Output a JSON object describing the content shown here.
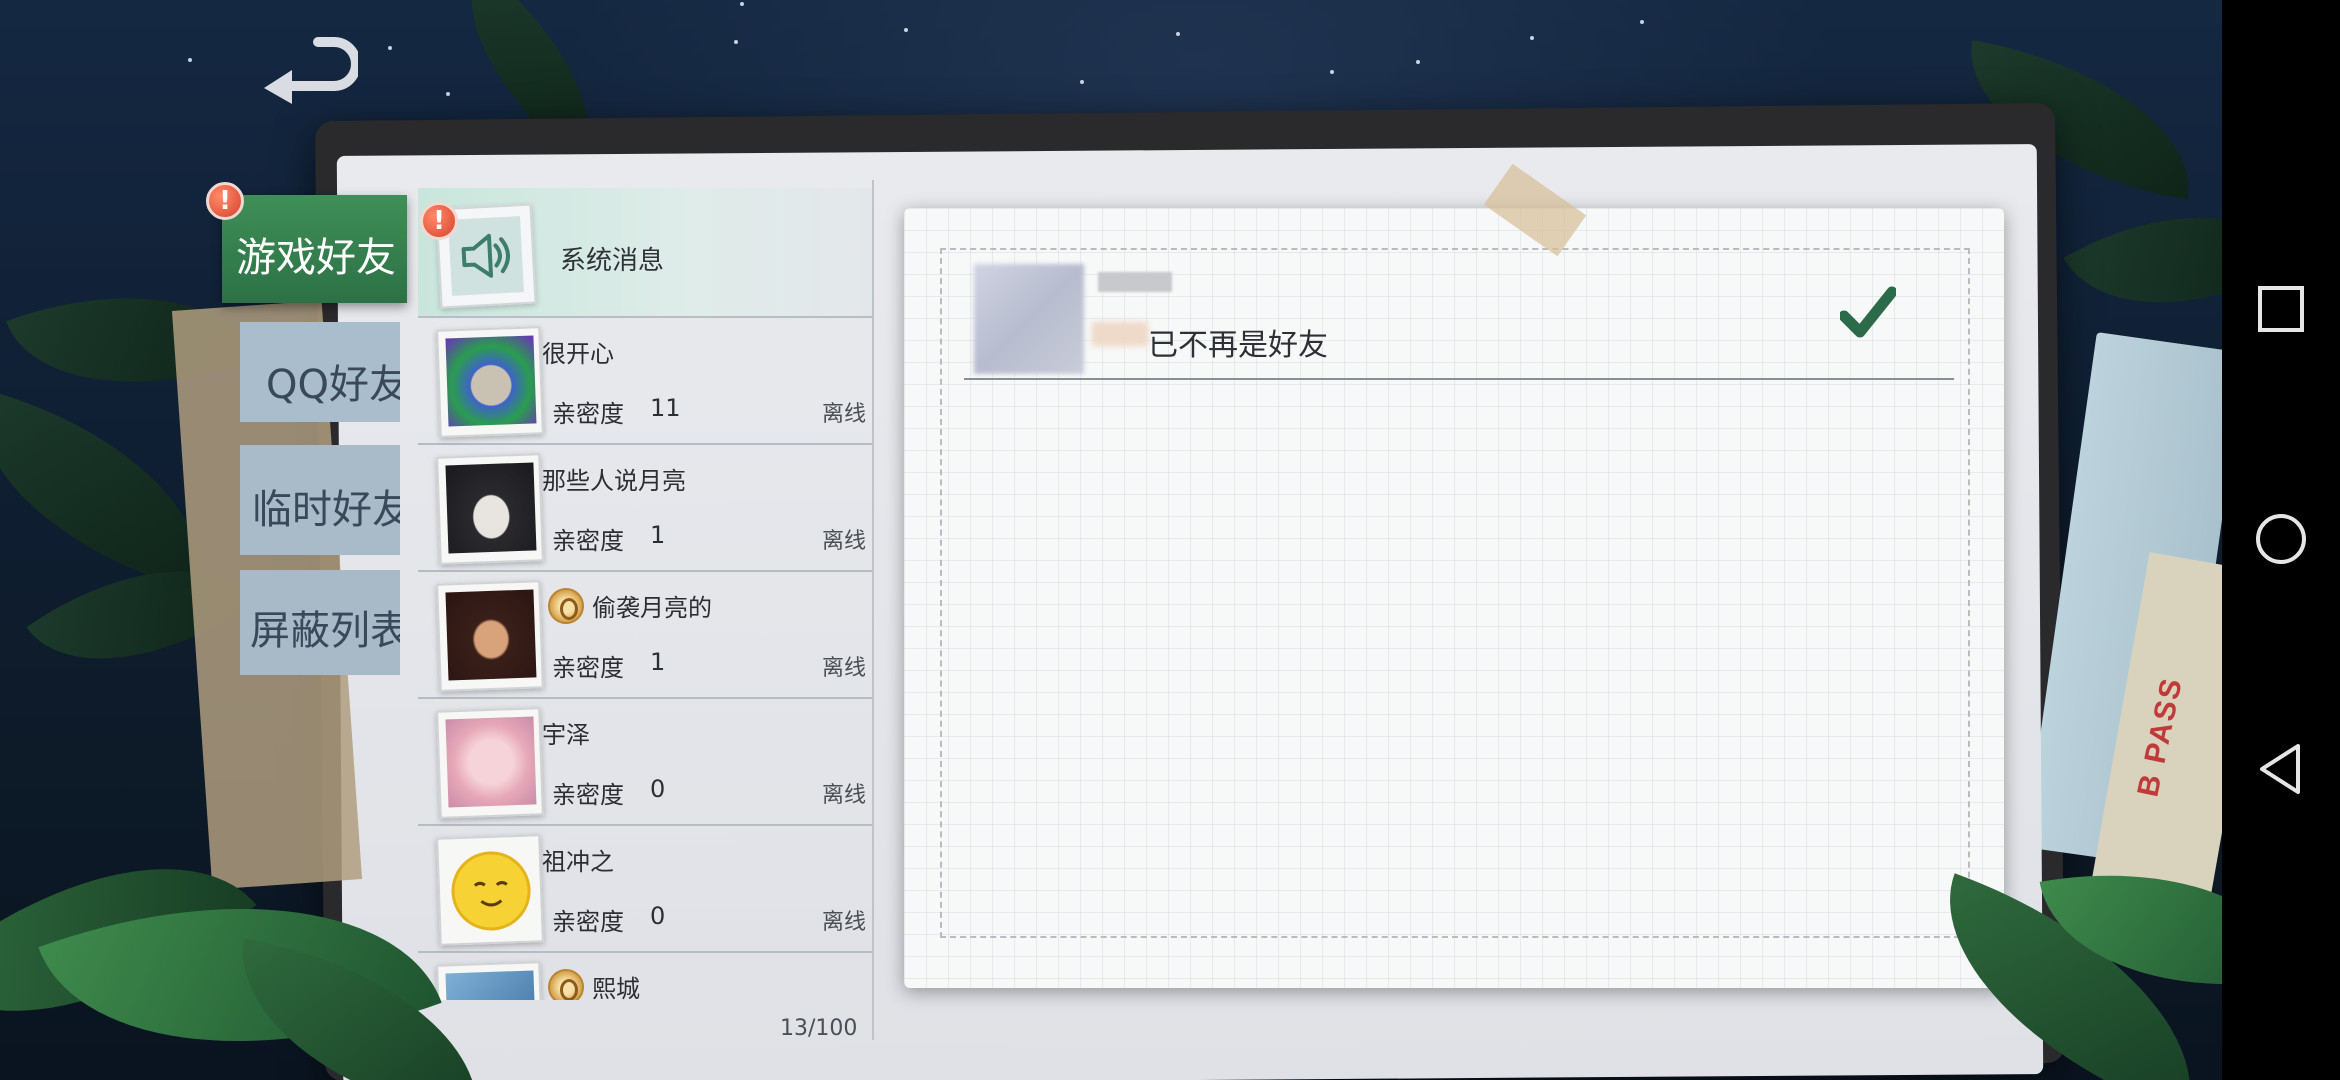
{
  "tabs": {
    "game_friends": "游戏好友",
    "qq_friends": "QQ好友",
    "temp_friends": "临时好友",
    "blocked_list": "屏蔽列表"
  },
  "alert_symbol": "!",
  "system_message": {
    "title": "系统消息",
    "icon": "speaker-icon"
  },
  "friends": [
    {
      "name": "很开心",
      "intimacy_label": "亲密度",
      "intimacy": "11",
      "status": "离线"
    },
    {
      "name": "那些人说月亮",
      "intimacy_label": "亲密度",
      "intimacy": "1",
      "status": "离线"
    },
    {
      "name": "偷袭月亮的",
      "intimacy_label": "亲密度",
      "intimacy": "1",
      "status": "离线"
    },
    {
      "name": "宇泽",
      "intimacy_label": "亲密度",
      "intimacy": "0",
      "status": "离线"
    },
    {
      "name": "祖冲之",
      "intimacy_label": "亲密度",
      "intimacy": "0",
      "status": "离线"
    },
    {
      "name": "熙城",
      "intimacy_label": "",
      "intimacy": "",
      "status": ""
    }
  ],
  "friend_count": "13/100",
  "message": {
    "text": "已不再是好友"
  },
  "decor": {
    "boarding_pass": "B PASS"
  },
  "colors": {
    "active_tab": "#3f8f58",
    "inactive_tab": "#aabdcc",
    "alert": "#d6432d",
    "check": "#2c6b4a"
  }
}
